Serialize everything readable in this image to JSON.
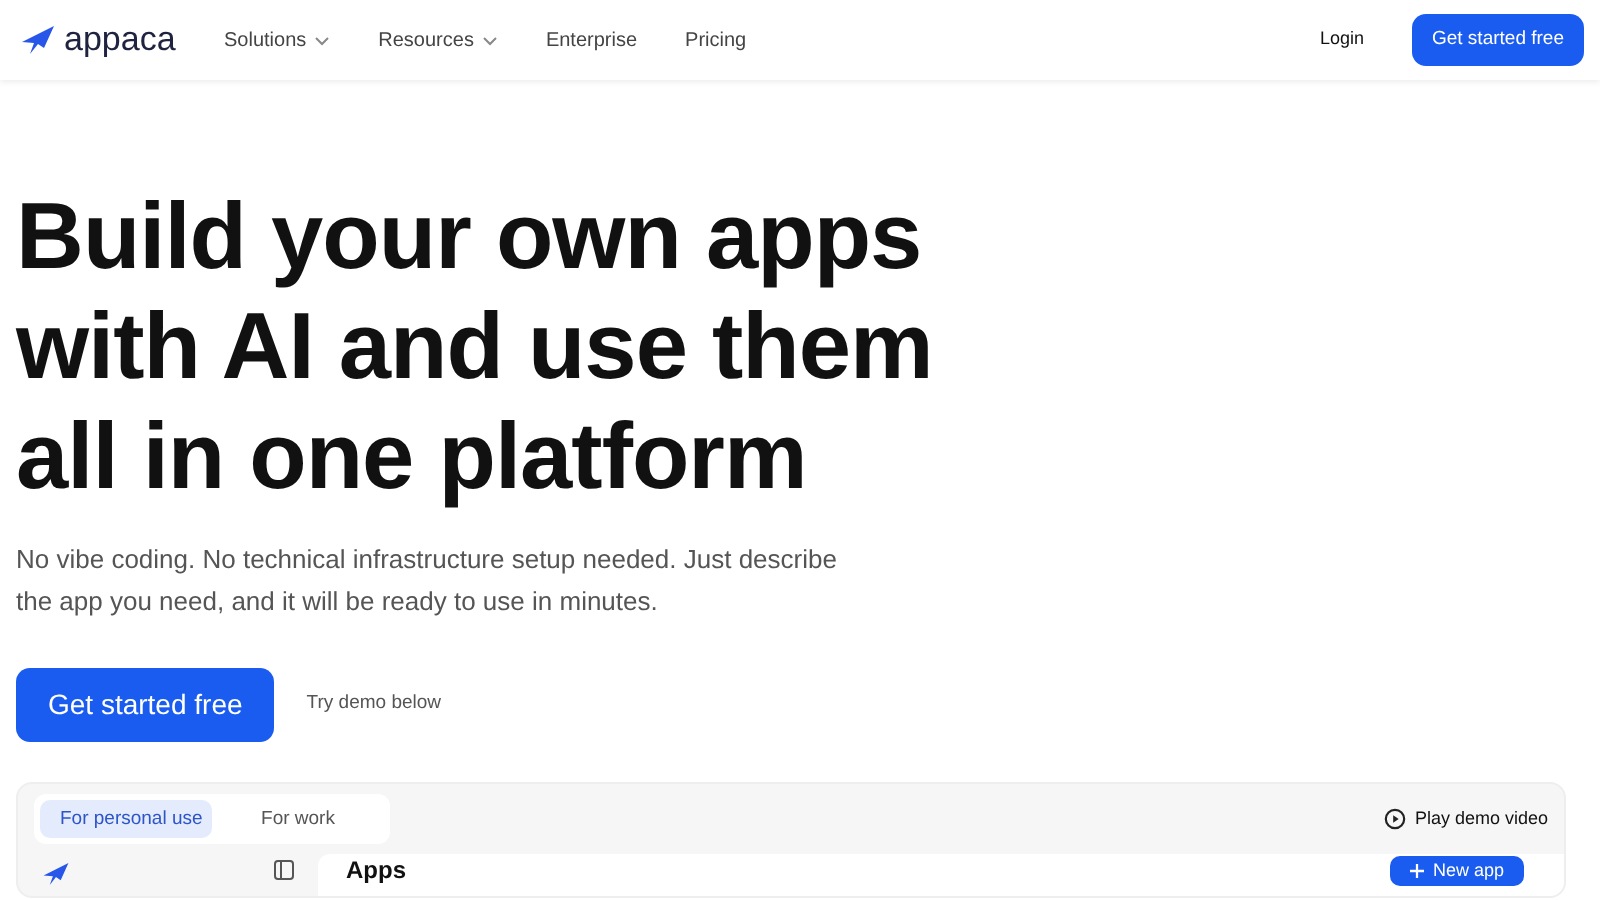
{
  "nav": {
    "brand": "appaca",
    "items": [
      {
        "label": "Solutions",
        "dropdown": true
      },
      {
        "label": "Resources",
        "dropdown": true
      },
      {
        "label": "Enterprise",
        "dropdown": false
      },
      {
        "label": "Pricing",
        "dropdown": false
      }
    ],
    "login": "Login",
    "cta": "Get started free"
  },
  "hero": {
    "title": "Build your own apps with AI and use them all in one platform",
    "subtitle": "No vibe coding. No technical infrastructure setup needed. Just describe the app you need, and it will be ready to use in minutes.",
    "cta": "Get started free",
    "secondary": "Try demo below"
  },
  "demo": {
    "tabs": [
      {
        "label": "For personal use",
        "selected": true
      },
      {
        "label": "For work",
        "selected": false
      }
    ],
    "video": "Play demo video",
    "heading": "Apps",
    "new_app": "New app"
  }
}
